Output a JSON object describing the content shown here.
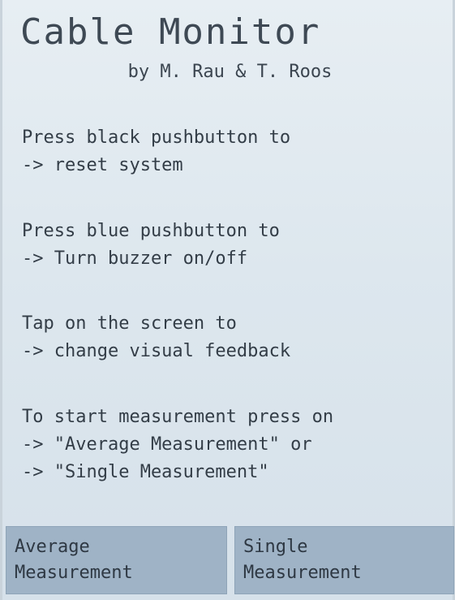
{
  "header": {
    "title": "Cable Monitor",
    "subtitle": "by M. Rau & T. Roos"
  },
  "instructions": [
    {
      "line1": "Press black pushbutton to",
      "line2": "-> reset system"
    },
    {
      "line1": "Press blue pushbutton to",
      "line2": "-> Turn buzzer on/off"
    },
    {
      "line1": "Tap on the screen to",
      "line2": "-> change visual feedback"
    },
    {
      "line1": "To start measurement press on",
      "line2": "-> \"Average Measurement\" or",
      "line3": "-> \"Single Measurement\""
    }
  ],
  "buttons": {
    "average": {
      "line1": "Average",
      "line2": "Measurement"
    },
    "single": {
      "line1": "Single",
      "line2": "Measurement"
    }
  },
  "colors": {
    "screen_background": "#dde7ee",
    "button_background": "#9fb3c6",
    "text": "#333d47"
  }
}
